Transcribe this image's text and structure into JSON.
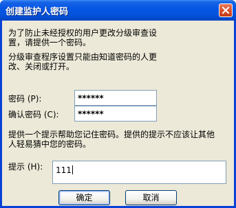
{
  "window": {
    "title": "创建监护人密码"
  },
  "intro": {
    "line1": "为了防止未经授权的用户更改分级审查设",
    "line2": "置，请提供一个密码。"
  },
  "info": {
    "line1": "分级审查程序设置只能由知道密码的人更",
    "line2": "改、关闭或打开。"
  },
  "password": {
    "label": "密码 (P):",
    "value": "******"
  },
  "confirm": {
    "label": "确认密码 (C):",
    "value": "******"
  },
  "hint_help": {
    "line1": "提供一个提示帮助您记住密码。提供的提示不应该让其他",
    "line2": "人轻易猜中您的密码。"
  },
  "hint": {
    "label": "提示 (H):",
    "value": "111"
  },
  "buttons": {
    "ok_label": "确定",
    "cancel_label": "取消"
  },
  "colors": {
    "titlebar": "#0456e4",
    "dialog_bg": "#ece9d8",
    "close_button": "#d94b25"
  },
  "icons": {
    "close": "close-x-icon"
  }
}
